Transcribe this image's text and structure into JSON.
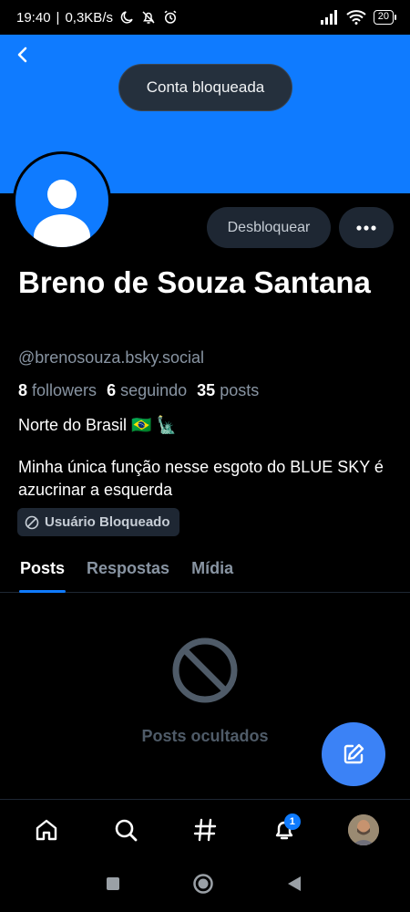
{
  "status_bar": {
    "time": "19:40",
    "speed": "0,3KB/s",
    "battery": "20"
  },
  "toast": {
    "text": "Conta bloqueada"
  },
  "profile": {
    "display_name": "Breno de Souza Santana",
    "handle": "@brenosouza.bsky.social",
    "followers_count": "8",
    "followers_label": "followers",
    "following_count": "6",
    "following_label": "seguindo",
    "posts_count": "35",
    "posts_label": "posts",
    "bio_line1": "Norte do Brasil 🇧🇷 🗽",
    "bio_line2": "Minha única função nesse esgoto do BLUE SKY é azucrinar a esquerda",
    "blocked_badge": "Usuário Bloqueado"
  },
  "actions": {
    "unblock_label": "Desbloquear"
  },
  "tabs": [
    {
      "label": "Posts",
      "active": true
    },
    {
      "label": "Respostas",
      "active": false
    },
    {
      "label": "Mídia",
      "active": false
    }
  ],
  "feed": {
    "hidden_text": "Posts ocultados"
  },
  "bottom_nav": {
    "items": [
      {
        "icon": "home-icon"
      },
      {
        "icon": "search-icon"
      },
      {
        "icon": "hashtag-icon"
      },
      {
        "icon": "bell-icon",
        "badge": "1"
      },
      {
        "icon": "profile-avatar"
      }
    ]
  },
  "colors": {
    "accent": "#0f7bff",
    "background": "#000000",
    "secondary_text": "#8894a2"
  }
}
